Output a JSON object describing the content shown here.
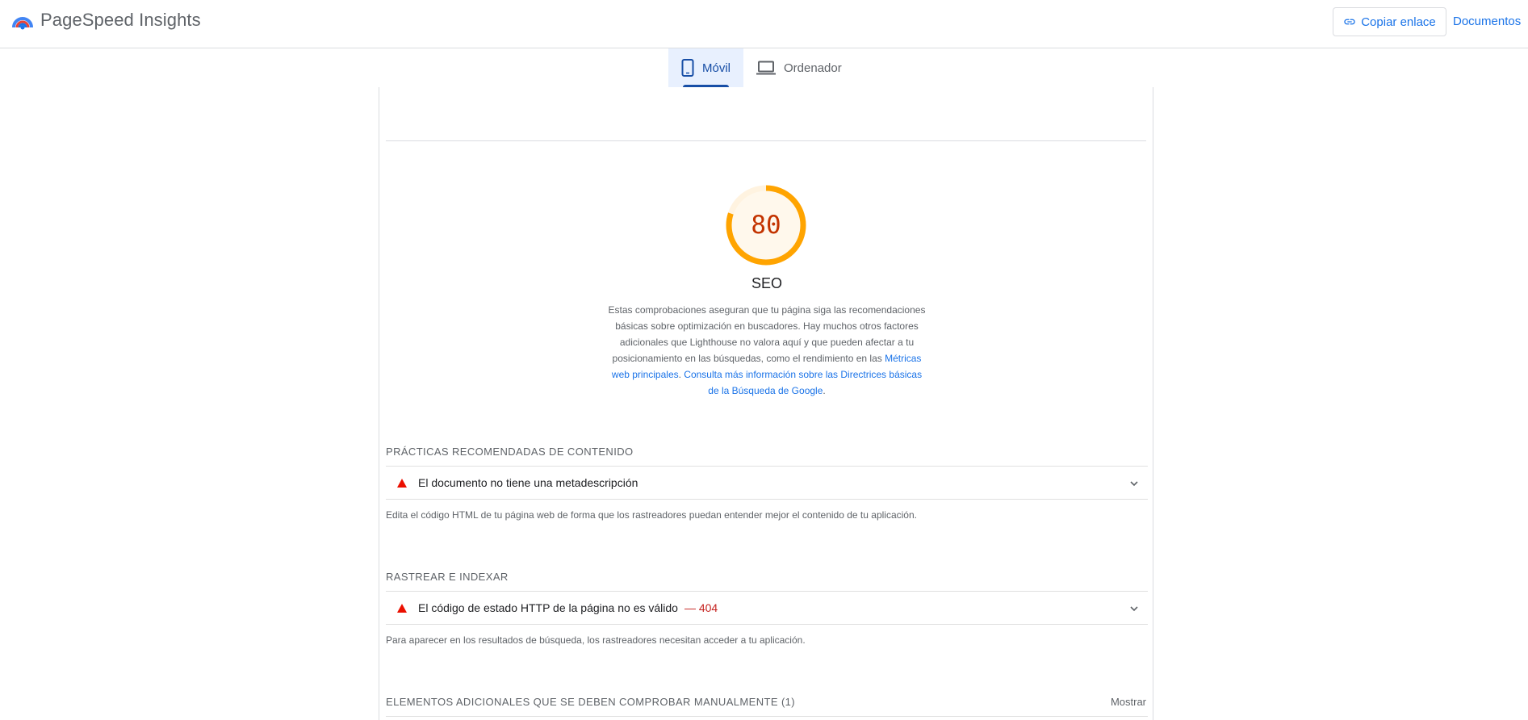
{
  "header": {
    "app_name": "PageSpeed Insights",
    "copy_link_label": "Copiar enlace",
    "docs_label": "Documentos"
  },
  "tabs": [
    {
      "label": "Móvil",
      "icon": "smartphone-icon",
      "active": true
    },
    {
      "label": "Ordenador",
      "icon": "laptop-icon",
      "active": false
    }
  ],
  "score": {
    "value": "80",
    "fraction": 0.8,
    "color": "#fa3",
    "text_color": "#c33300",
    "title": "SEO",
    "description_text": "Estas comprobaciones aseguran que tu página siga las recomendaciones básicas sobre optimización en buscadores. Hay muchos otros factores adicionales que Lighthouse no valora aquí y que pueden afectar a tu posicionamiento en las búsquedas, como el rendimiento en las ",
    "description_link": "Métricas web principales",
    "description_sep": ". ",
    "description_link2": "Consulta más información sobre las Directrices básicas de la Búsqueda de Google",
    "description_end": "."
  },
  "groups": [
    {
      "title": "Prácticas recomendadas de contenido",
      "audit_title": "El documento no tiene una metadescripción",
      "audit_value": "",
      "description": "Edita el código HTML de tu página web de forma que los rastreadores puedan entender mejor el contenido de tu aplicación."
    },
    {
      "title": "Rastrear e indexar",
      "audit_title": "El código de estado HTTP de la página no es válido",
      "audit_value": "— 404",
      "description": "Para aparecer en los resultados de búsqueda, los rastreadores necesitan acceder a tu aplicación."
    },
    {
      "title": "Elementos adicionales que se deben comprobar manualmente",
      "count": "(1)",
      "show_label": "Mostrar"
    }
  ],
  "colors": {
    "accent": "#1a73e8",
    "fail": "#eb0f00",
    "average": "#ffa400"
  }
}
